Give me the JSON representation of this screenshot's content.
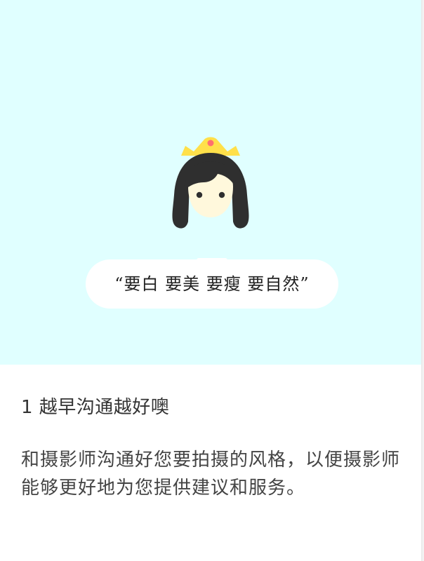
{
  "hero": {
    "background_color": "#e0ffff",
    "illustration_icon": "princess-with-crown-icon",
    "bubble_text": "“要白 要美 要瘦 要自然”"
  },
  "tip": {
    "title": "1 越早沟通越好噢",
    "body": "和摄影师沟通好您要拍摄的风格，以便摄影师能够更好地为您提供建议和服务。"
  }
}
